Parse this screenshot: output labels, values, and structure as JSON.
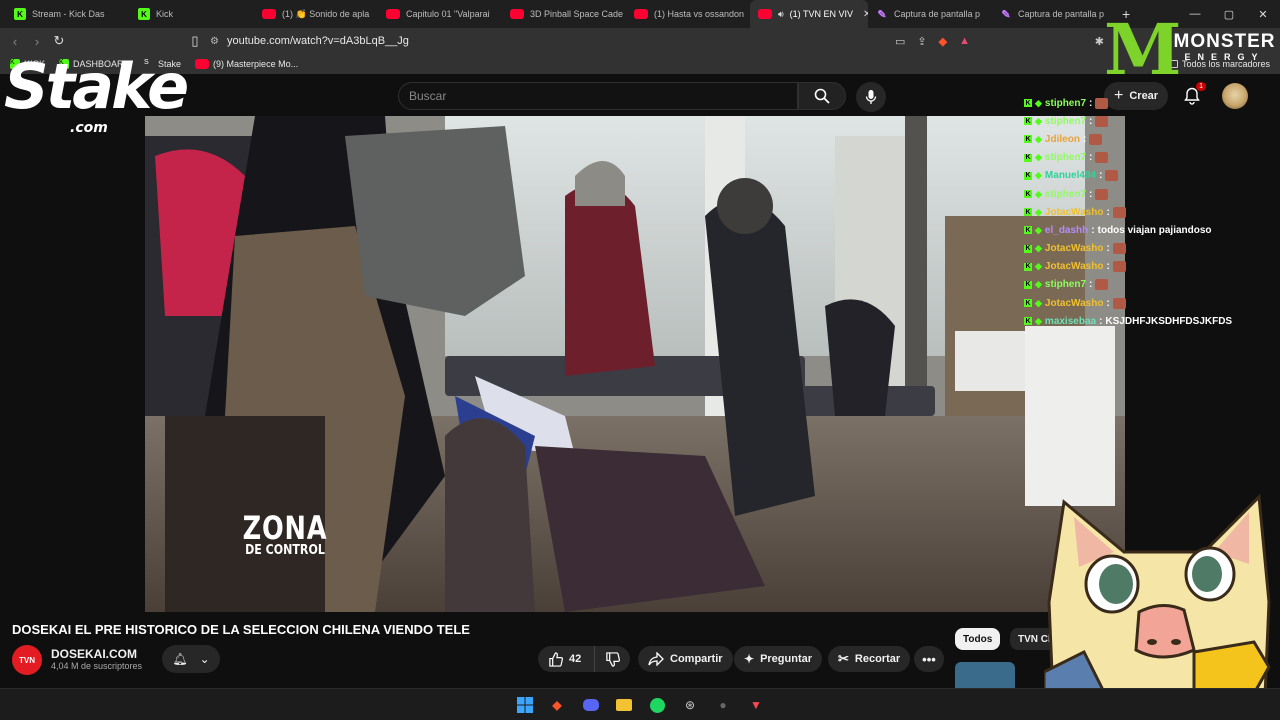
{
  "tabs": [
    {
      "label": "Stream - Kick Das",
      "icon": "kick"
    },
    {
      "label": "Kick",
      "icon": "kick"
    },
    {
      "label": "(1) 👏 Sonido de apla",
      "icon": "yt"
    },
    {
      "label": "Capitulo 01 \"Valparai",
      "icon": "yt"
    },
    {
      "label": "3D Pinball Space Cade",
      "icon": "yt"
    },
    {
      "label": "(1) Hasta vs ossandon",
      "icon": "yt"
    },
    {
      "label": "(1) TVN EN VIV",
      "icon": "yt",
      "active": true
    },
    {
      "label": "Captura de pantalla p",
      "icon": "pen"
    },
    {
      "label": "Captura de pantalla p",
      "icon": "pen"
    }
  ],
  "address": {
    "url": "youtube.com/watch?v=dA3bLqB__Jg"
  },
  "bookmarks": {
    "items": [
      {
        "label": "KICK",
        "icon": "kick"
      },
      {
        "label": "DASHBOARD",
        "icon": "kick"
      },
      {
        "label": "Stake",
        "icon": "stake"
      },
      {
        "label": "(9) Masterpiece Mo...",
        "icon": "yt"
      }
    ],
    "all_label": "Todos los marcadores"
  },
  "youtube": {
    "search_placeholder": "Buscar",
    "create_label": "Crear",
    "notif_count": "1",
    "video_overlay": {
      "line1": "ZONA",
      "line2": "DE CONTROL"
    },
    "video_title": "DOSEKAI EL PRE HISTORICO DE LA SELECCION CHILENA VIENDO TELE",
    "channel": {
      "avatar_text": "TVN",
      "name": "DOSEKAI.COM",
      "subs": "4,04 M de suscriptores"
    },
    "actions": {
      "likes": "42",
      "share": "Compartir",
      "ask": "Preguntar",
      "clip": "Recortar"
    },
    "chips": [
      "Todos",
      "TVN Chi"
    ]
  },
  "overlay": {
    "stake_logo": {
      "name": "Stake",
      "suffix": ".com"
    },
    "monster": {
      "name": "MONSTER",
      "sub": "ENERGY"
    },
    "chat": [
      {
        "user": "stiphen7",
        "color": "#8cff5a",
        "text": ""
      },
      {
        "user": "stiphen7",
        "color": "#8cff5a",
        "text": ""
      },
      {
        "user": "Jdileon",
        "color": "#e8a33c",
        "text": ""
      },
      {
        "user": "stiphen7",
        "color": "#8cff5a",
        "text": ""
      },
      {
        "user": "Manuel494",
        "color": "#2fd39a",
        "text": ""
      },
      {
        "user": "stiphen7",
        "color": "#8cff5a",
        "text": ""
      },
      {
        "user": "JotacWasho",
        "color": "#f0c030",
        "text": ""
      },
      {
        "user": "el_dashh",
        "color": "#b48cff",
        "text": "todos viajan pajiandoso"
      },
      {
        "user": "JotacWasho",
        "color": "#f0c030",
        "text": ""
      },
      {
        "user": "JotacWasho",
        "color": "#f0c030",
        "text": ""
      },
      {
        "user": "stiphen7",
        "color": "#8cff5a",
        "text": ""
      },
      {
        "user": "JotacWasho",
        "color": "#f0c030",
        "text": ""
      },
      {
        "user": "maxisebaa",
        "color": "#6fe0b8",
        "text": "KSJDHFJKSDHFDSJKFDS"
      }
    ]
  },
  "colors": {
    "youtube_red": "#ff0033",
    "kick_green": "#53fc18",
    "monster_green": "#7dd329",
    "background": "#0f0f0f"
  },
  "taskbar": {
    "icons": [
      "windows-icon",
      "brave-icon",
      "discord-icon",
      "explorer-icon",
      "spotify-icon",
      "steam-icon",
      "obs-icon",
      "valorant-icon"
    ]
  }
}
